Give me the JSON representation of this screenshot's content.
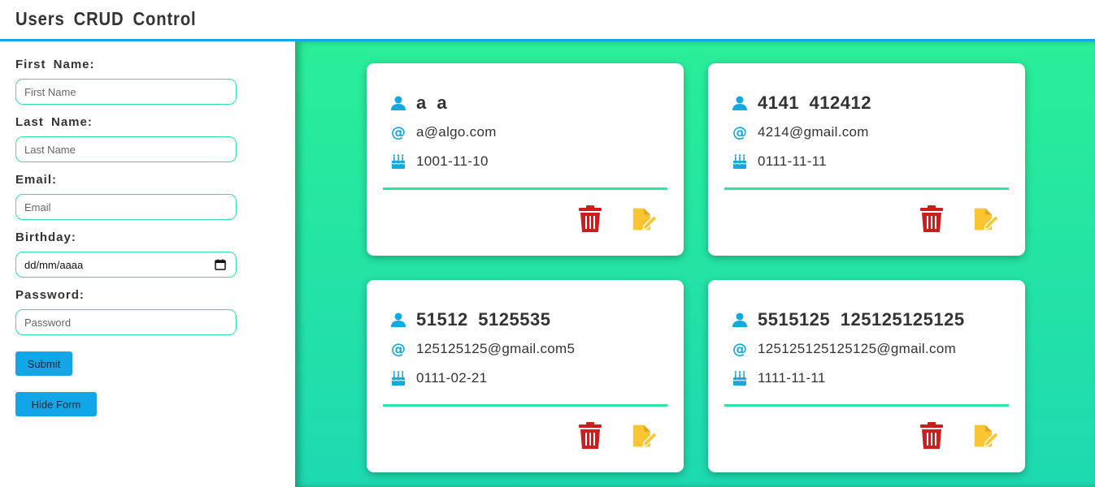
{
  "header": {
    "title": "Users CRUD Control"
  },
  "form": {
    "first_name": {
      "label": "First Name:",
      "placeholder": "First Name"
    },
    "last_name": {
      "label": "Last Name:",
      "placeholder": "Last Name"
    },
    "email": {
      "label": "Email:",
      "placeholder": "Email"
    },
    "birthday": {
      "label": "Birthday:",
      "value": "dd/mm/aaaa"
    },
    "password": {
      "label": "Password:",
      "placeholder": "Password"
    },
    "submit_label": "Submit",
    "hide_form_label": "Hide Form"
  },
  "cards": [
    {
      "name": "a a",
      "email": "a@algo.com",
      "birthday": "1001-11-10"
    },
    {
      "name": "4141 412412",
      "email": "4214@gmail.com",
      "birthday": "0111-11-11"
    },
    {
      "name": "51512 5125535",
      "email": "125125125@gmail.com5",
      "birthday": "0111-02-21"
    },
    {
      "name": "5515125 125125125125",
      "email": "125125125125125@gmail.com",
      "birthday": "1111-11-11"
    }
  ],
  "colors": {
    "accent_blue": "#14a8e0",
    "accent_green": "#2ee59d",
    "delete_red": "#c91f1f",
    "edit_yellow": "#fbc531"
  },
  "icons": {
    "name": "user-icon",
    "email": "at-icon",
    "birthday": "birthday-cake-icon",
    "delete": "trash-icon",
    "edit": "edit-file-icon"
  }
}
